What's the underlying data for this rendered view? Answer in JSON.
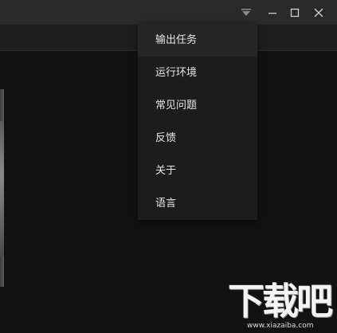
{
  "titlebar": {
    "buttons": [
      {
        "name": "menu-dropdown",
        "icon": "dropdown-arrow-icon"
      },
      {
        "name": "minimize",
        "icon": "minimize-icon"
      },
      {
        "name": "maximize",
        "icon": "maximize-icon"
      },
      {
        "name": "close",
        "icon": "close-icon"
      }
    ]
  },
  "menu": {
    "items": [
      {
        "label": "输出任务"
      },
      {
        "label": "运行环境"
      },
      {
        "label": "常见问题"
      },
      {
        "label": "反馈"
      },
      {
        "label": "关于"
      },
      {
        "label": "语言"
      }
    ]
  },
  "watermark": {
    "text": "下载吧",
    "url": "www.xiazaiba.com"
  },
  "colors": {
    "background": "#121212",
    "titlebar": "#2a2a2a",
    "menu_bg": "#1c1c1c",
    "menu_hover": "#262626",
    "text": "#e6e6e6"
  }
}
